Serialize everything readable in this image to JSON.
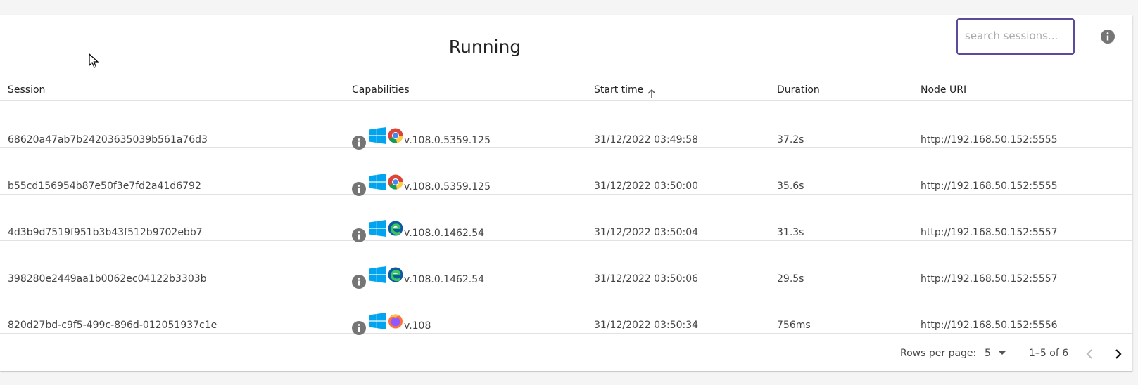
{
  "panel": {
    "title": "Running",
    "search": {
      "placeholder": "search sessions...",
      "value": ""
    }
  },
  "columns": [
    "Session",
    "Capabilities",
    "Start time",
    "Duration",
    "Node URI"
  ],
  "sort": {
    "column": "Start time",
    "direction": "ascending",
    "icon": "arrow-up-icon"
  },
  "rows": [
    {
      "session": "68620a47ab7b24203635039b561a76d3",
      "os": "windows",
      "browser": "chrome",
      "version": "v.108.0.5359.125",
      "start": "31/12/2022 03:49:58",
      "duration": "37.2s",
      "node": "http://192.168.50.152:5555"
    },
    {
      "session": "b55cd156954b87e50f3e7fd2a41d6792",
      "os": "windows",
      "browser": "chrome",
      "version": "v.108.0.5359.125",
      "start": "31/12/2022 03:50:00",
      "duration": "35.6s",
      "node": "http://192.168.50.152:5555"
    },
    {
      "session": "4d3b9d7519f951b3b43f512b9702ebb7",
      "os": "windows",
      "browser": "edge",
      "version": "v.108.0.1462.54",
      "start": "31/12/2022 03:50:04",
      "duration": "31.3s",
      "node": "http://192.168.50.152:5557"
    },
    {
      "session": "398280e2449aa1b0062ec04122b3303b",
      "os": "windows",
      "browser": "edge",
      "version": "v.108.0.1462.54",
      "start": "31/12/2022 03:50:06",
      "duration": "29.5s",
      "node": "http://192.168.50.152:5557"
    },
    {
      "session": "820d27bd-c9f5-499c-896d-012051937c1e",
      "os": "windows",
      "browser": "firefox",
      "version": "v.108",
      "start": "31/12/2022 03:50:34",
      "duration": "756ms",
      "node": "http://192.168.50.152:5556"
    }
  ],
  "pagination": {
    "rows_per_page_label": "Rows per page:",
    "rows_per_page_value": "5",
    "range_label": "1–5 of 6"
  },
  "icons": {
    "info": "info-icon",
    "windows": "windows-icon",
    "chrome": "chrome-icon",
    "edge": "edge-icon",
    "firefox": "firefox-icon",
    "prev": "chevron-left-icon",
    "next": "chevron-right-icon",
    "dropdown": "dropdown-arrow-icon"
  },
  "colors": {
    "accent": "#5b4b9a",
    "info_icon": "#757575",
    "windows_blue": "#00a4ef"
  }
}
